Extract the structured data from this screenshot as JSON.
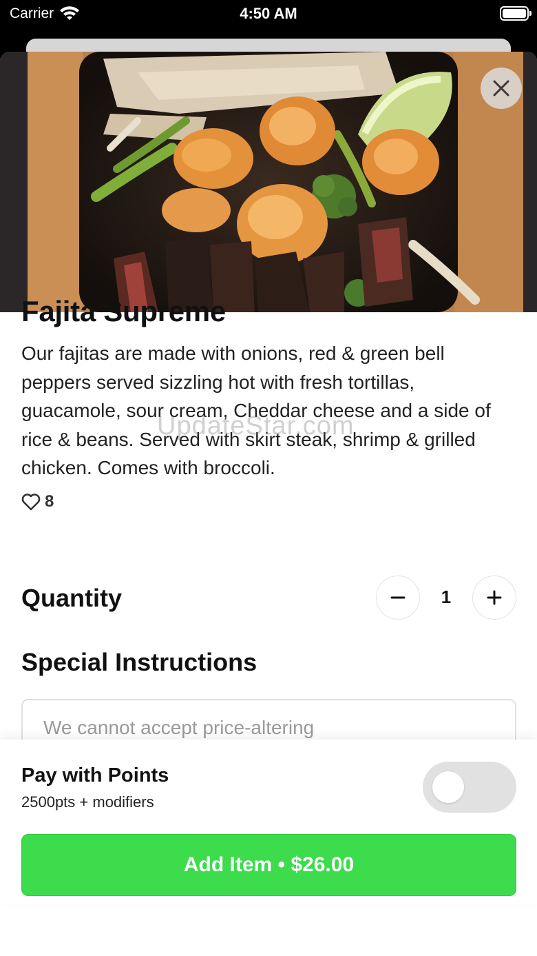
{
  "status_bar": {
    "carrier": "Carrier",
    "time": "4:50 AM"
  },
  "item": {
    "title": "Fajita Supreme",
    "description": "Our fajitas are made with onions, red & green bell peppers served sizzling hot with fresh tortillas, guacamole, sour cream, Cheddar cheese and a side of rice & beans. Served with skirt steak, shrimp & grilled chicken. Comes with broccoli.",
    "likes": "8"
  },
  "watermark": "UpdateStar.com",
  "quantity": {
    "label": "Quantity",
    "value": "1"
  },
  "special_instructions": {
    "label": "Special Instructions",
    "placeholder": "We cannot accept price-altering",
    "value": ""
  },
  "points": {
    "title": "Pay with Points",
    "subtitle": "2500pts + modifiers",
    "enabled": false
  },
  "add_button": {
    "label": "Add Item • $26.00"
  },
  "colors": {
    "accent_green": "#3ddc4d",
    "toggle_off": "#e1e1e1"
  },
  "icons": [
    "wifi-icon",
    "battery-icon",
    "close-icon",
    "heart-icon",
    "minus-icon",
    "plus-icon"
  ]
}
